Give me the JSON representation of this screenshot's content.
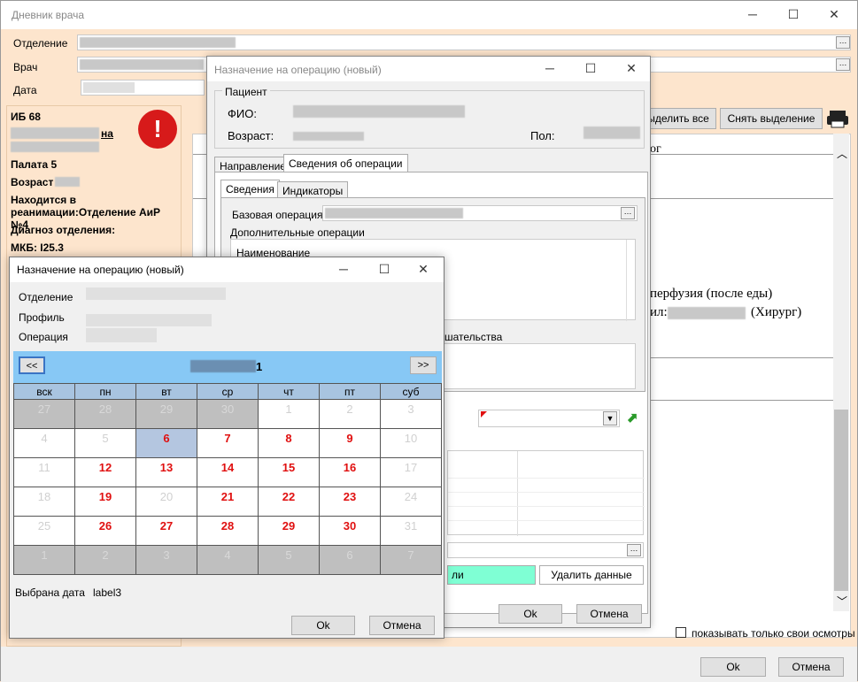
{
  "main_window": {
    "title": "Дневник врача",
    "labels": {
      "department": "Отделение",
      "doctor": "Врач",
      "date": "Дата"
    },
    "toolbar": {
      "select_all": "Выделить все",
      "deselect": "Снять выделение"
    },
    "show_own_checkbox": "показывать только свои осмотры",
    "ok": "Ok",
    "cancel": "Отмена",
    "doc_fragment_1": "ог",
    "doc_fragment_2": "перфузия (после еды)",
    "doc_fragment_3": "ил:",
    "doc_fragment_4": "(Хирург)"
  },
  "patient_panel": {
    "ib": "ИБ 68",
    "name_tail": "на",
    "ward": "Палата 5",
    "age_label": "Возраст",
    "location": "Находится в реанимации:Отделение АиР №4",
    "diagnosis_label": "Диагноз отделения:",
    "mkb": "МКБ: I25.3"
  },
  "op_dialog": {
    "title": "Назначение на операцию (новый)",
    "patient_group": "Пациент",
    "fio_label": "ФИО:",
    "age_label": "Возраст:",
    "sex_label": "Пол:",
    "tabs": [
      "Направление",
      "Сведения об операции"
    ],
    "subtabs": [
      "Сведения",
      "Индикаторы"
    ],
    "base_op_label": "Базовая операция",
    "extra_ops_label": "Дополнительные операции",
    "col_name": "Наименование",
    "intervention_label": "шательства",
    "green_button": "ли",
    "delete_data": "Удалить данные",
    "ok": "Ok",
    "cancel": "Отмена"
  },
  "cal_dialog": {
    "title": "Назначение на операцию (новый)",
    "labels": {
      "department": "Отделение",
      "profile": "Профиль",
      "operation": "Операция"
    },
    "prev": "<<",
    "next": ">>",
    "month_suffix": "1",
    "weekdays": [
      "вск",
      "пн",
      "вт",
      "ср",
      "чт",
      "пт",
      "суб"
    ],
    "weeks": [
      [
        "27",
        "28",
        "29",
        "30",
        "1",
        "2",
        "3"
      ],
      [
        "4",
        "5",
        "6",
        "7",
        "8",
        "9",
        "10"
      ],
      [
        "11",
        "12",
        "13",
        "14",
        "15",
        "16",
        "17"
      ],
      [
        "18",
        "19",
        "20",
        "21",
        "22",
        "23",
        "24"
      ],
      [
        "25",
        "26",
        "27",
        "28",
        "29",
        "30",
        "31"
      ],
      [
        "1",
        "2",
        "3",
        "4",
        "5",
        "6",
        "7"
      ]
    ],
    "selected_label": "Выбрана дата",
    "selected_value": "label3",
    "ok": "Ok",
    "cancel": "Отмена"
  },
  "colors": {
    "peach": "#fde5cd",
    "header_blue": "#87c8f5",
    "day_red": "#e01010",
    "selected_day": "#b4c6e0",
    "alert_red": "#d71a1a"
  }
}
